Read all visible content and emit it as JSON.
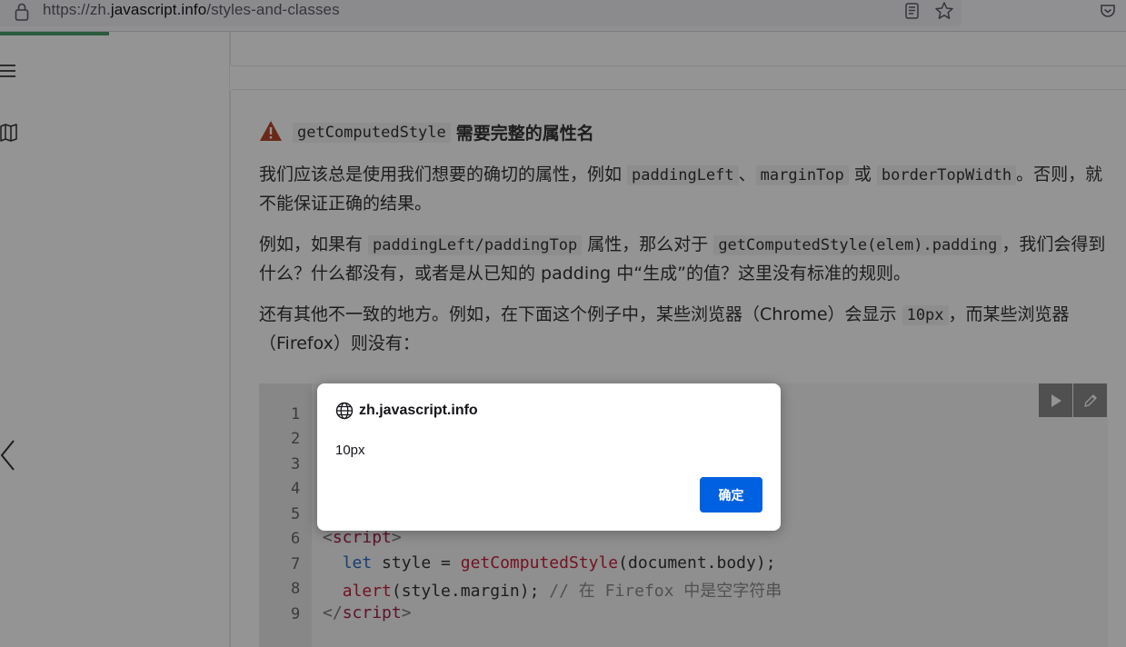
{
  "browser": {
    "url_prefix": "https://zh.",
    "url_domain": "javascript.info",
    "url_path": "/styles-and-classes"
  },
  "article": {
    "heading_code": "getComputedStyle",
    "heading_text": "需要完整的属性名",
    "p1": {
      "t1": "我们应该总是使用我们想要的确切的属性，例如 ",
      "c1": "paddingLeft",
      "t2": "、",
      "c2": "marginTop",
      "t3": " 或 ",
      "c3": "borderTopWidth",
      "t4": "。否则，就不能保证正确的结果。"
    },
    "p2": {
      "t1": "例如，如果有 ",
      "c1": "paddingLeft/paddingTop",
      "t2": " 属性，那么对于 ",
      "c2": "getComputedStyle(elem).padding",
      "t3": "，我们会得到什么？什么都没有，或者是从已知的 padding 中“生成”的值？这里没有标准的规则。"
    },
    "p3": {
      "t1": "还有其他不一致的地方。例如，在下面这个例子中，某些浏览器（Chrome）会显示 ",
      "c1": "10px",
      "t2": "，而某些浏览器（Firefox）则没有："
    }
  },
  "code": {
    "line_numbers": [
      "1",
      "2",
      "3",
      "4",
      "5",
      "6",
      "7",
      "8",
      "9"
    ],
    "line6": {
      "open": "<",
      "tag": "script",
      "close": ">"
    },
    "line7": {
      "kw": "let",
      "rest1": " style = ",
      "fn": "getComputedStyle",
      "rest2": "(document.body);"
    },
    "line8": {
      "fn": "alert",
      "rest": "(style.margin); ",
      "comment": "// 在 Firefox 中是空字符串"
    },
    "line9": {
      "open": "</",
      "tag": "script",
      "close": ">"
    }
  },
  "dialog": {
    "origin": "zh.javascript.info",
    "message": "10px",
    "ok_label": "确定"
  },
  "colors": {
    "accent": "#0061e0",
    "warning": "#b5482b",
    "progress": "#4b9e6a"
  }
}
